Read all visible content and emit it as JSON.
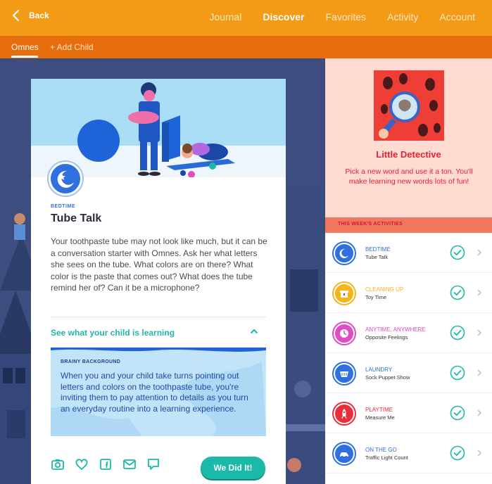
{
  "header": {
    "back_label": "Back",
    "nav": [
      "Journal",
      "Discover",
      "Favorites",
      "Activity",
      "Account"
    ],
    "active_nav": "Discover"
  },
  "subnav": {
    "child_name": "Omnes",
    "add_child": "+ Add Child"
  },
  "card": {
    "category": "BEDTIME",
    "title": "Tube Talk",
    "description": "Your toothpaste tube may not look like much, but it can be a conversation starter with Omnes. Ask her what letters she sees on the tube. What colors are on there? What color is the paste that comes out? What does the tube remind her of? Can it be a microphone?",
    "learning_toggle": "See what your child is learning",
    "brainy_title": "BRAINY BACKGROUND",
    "brainy_body": "When you and your child take turns pointing out letters and colors on the toothpaste tube, you're inviting them to pay attention to details as you turn an everyday routine into a learning experience.",
    "did_it_label": "We Did It!",
    "icons": [
      "camera-icon",
      "heart-icon",
      "facebook-icon",
      "mail-icon",
      "comment-icon"
    ]
  },
  "feature": {
    "title": "Little Detective",
    "description": "Pick a new word and use it a ton. You'll make learning new words lots of fun!"
  },
  "week": {
    "heading": "THIS WEEK'S ACTIVITIES",
    "items": [
      {
        "category": "BEDTIME",
        "name": "Tube Talk",
        "color": "#2f6fe0",
        "icon": "moon-icon"
      },
      {
        "category": "CLEANING UP",
        "name": "Toy Time",
        "color": "#f4b41a",
        "icon": "toy-box-icon"
      },
      {
        "category": "ANYTIME, ANYWHERE",
        "name": "Opposite Feelings",
        "color": "#e14bc4",
        "icon": "clock-icon"
      },
      {
        "category": "LAUNDRY",
        "name": "Sock Puppet Show",
        "color": "#2f6fe0",
        "icon": "laundry-basket-icon"
      },
      {
        "category": "PLAYTIME",
        "name": "Measure Me",
        "color": "#ea2e3a",
        "icon": "rocket-icon"
      },
      {
        "category": "ON THE GO",
        "name": "Traffic Light Count",
        "color": "#2f6fe0",
        "icon": "car-icon"
      }
    ]
  },
  "colors": {
    "header": "#f39a16",
    "subheader": "#e86d0c",
    "teal": "#1ab9a8",
    "red": "#e6203b"
  }
}
